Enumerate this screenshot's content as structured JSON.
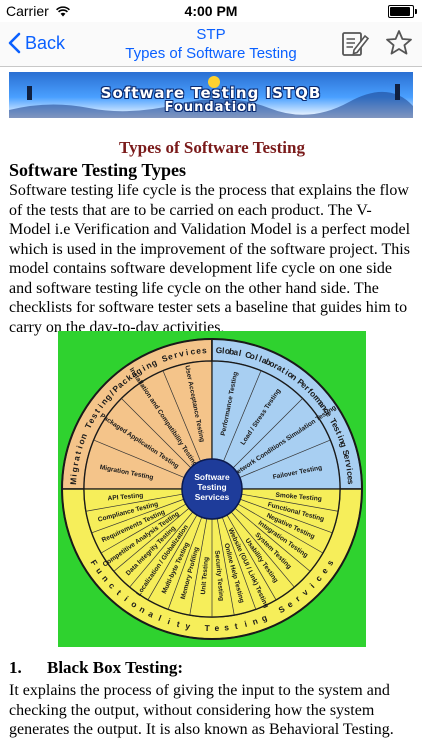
{
  "status_bar": {
    "carrier": "Carrier",
    "time": "4:00 PM",
    "battery_level": 0.9
  },
  "nav": {
    "back_label": "Back",
    "title_line1": "STP",
    "title_line2": "Types of Software Testing"
  },
  "banner": {
    "line1": "Software Testing ISTQB",
    "line2": "Foundation"
  },
  "content": {
    "section_title": "Types of Software Testing",
    "sub_title": "Software Testing Types",
    "intro": "Software testing life cycle is the process that explains the flow of the tests that are to be carried on each product. The V- Model i.e Verification and Validation Model is a perfect model which is used in the improvement of the software project. This model contains software development life cycle on one side and software testing life cycle on the other hand side. The checklists for software tester sets a baseline that guides him to carry on the day-to-day activities,",
    "black_box_number": "1.",
    "black_box_title": "Black Box Testing:",
    "black_box_text": "It explains the process of giving the input to the system and checking the output, without considering how the system generates the output. It is also known as Behavioral Testing."
  },
  "diagram": {
    "center": [
      "Software",
      "Testing",
      "Services"
    ],
    "ring_labels": {
      "migration": "Migration Testing/Packaging Services",
      "global": "Global Collaboration Performance Testing Services",
      "functionality": "Functionality Testing Services"
    },
    "migration_items": [
      "User Acceptance Testing",
      "Installation and Compatibility Testing",
      "Packaged Application Testing",
      "Migration Testing"
    ],
    "performance_items": [
      "Performance Testing",
      "Load / Stress Testing",
      "Network Conditions Simulation Testing",
      "Failover Testing"
    ],
    "functional_items": [
      "Smoke Testing",
      "Functional Testing",
      "Negative Testing",
      "Integration Testing",
      "System Testing",
      "Usability Testing",
      "Website (GUI / Link) Testing",
      "Online Help Testing",
      "Security Testing",
      "Unit Testing",
      "Memory Profiling",
      "Multi-byte Testing",
      "Localization / Globalization",
      "Data Integrity Testing",
      "Competitive Analysis Testing",
      "Requirements Testing",
      "Compliance Testing",
      "API Testing"
    ],
    "colors": {
      "background": "#2fd22f",
      "migration": "#f4c48a",
      "performance": "#a8cff2",
      "functional": "#f6ee5a",
      "center": "#1e3c9a",
      "ring": "#1a1a1a"
    }
  }
}
